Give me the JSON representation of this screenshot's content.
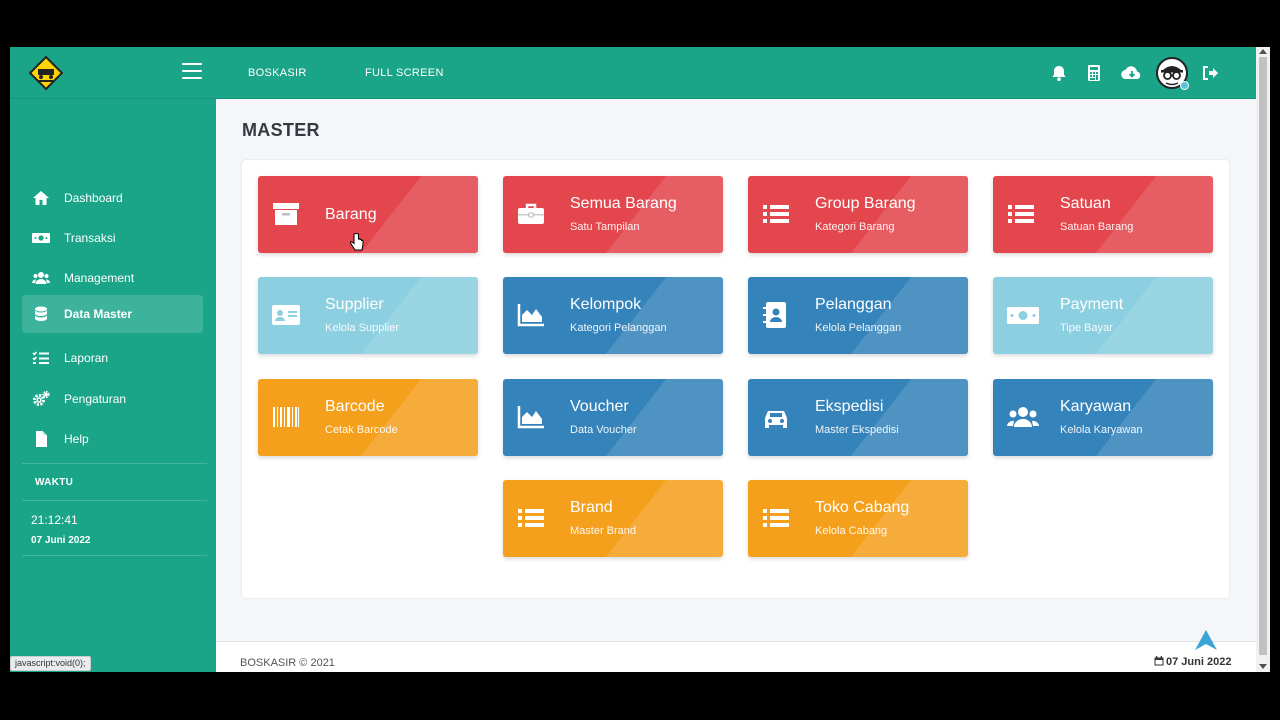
{
  "topbar": {
    "nav": [
      "BOSKASIR",
      "FULL SCREEN"
    ],
    "icons": [
      "bell-icon",
      "calculator-icon",
      "cloud-download-icon",
      "sign-out-icon"
    ],
    "accent": "#1aa589"
  },
  "sidebar": {
    "items": [
      {
        "label": "Dashboard",
        "icon": "home-icon"
      },
      {
        "label": "Transaksi",
        "icon": "money-icon"
      },
      {
        "label": "Management",
        "icon": "users-icon"
      },
      {
        "label": "Data Master",
        "icon": "database-icon",
        "active": true
      },
      {
        "label": "Laporan",
        "icon": "list-check-icon"
      },
      {
        "label": "Pengaturan",
        "icon": "cogs-icon"
      },
      {
        "label": "Help",
        "icon": "file-icon"
      }
    ],
    "waktu_header": "WAKTU",
    "clock": "21:12:41",
    "date": "07 Juni 2022"
  },
  "main": {
    "title": "MASTER",
    "tiles": [
      {
        "title": "Barang",
        "subtitle": "",
        "color": "#e3464c",
        "icon": "archive-icon"
      },
      {
        "title": "Semua Barang",
        "subtitle": "Satu Tampilan",
        "color": "#e3464c",
        "icon": "briefcase-icon"
      },
      {
        "title": "Group Barang",
        "subtitle": "Kategori Barang",
        "color": "#e3464c",
        "icon": "list-icon"
      },
      {
        "title": "Satuan",
        "subtitle": "Satuan Barang",
        "color": "#e3464c",
        "icon": "list-icon"
      },
      {
        "title": "Supplier",
        "subtitle": "Kelola Supplier",
        "color": "#8ccfe0",
        "icon": "id-card-icon"
      },
      {
        "title": "Kelompok",
        "subtitle": "Kategori Pelanggan",
        "color": "#3583bb",
        "icon": "area-chart-icon"
      },
      {
        "title": "Pelanggan",
        "subtitle": "Kelola Pelanggan",
        "color": "#3583bb",
        "icon": "address-book-icon"
      },
      {
        "title": "Payment",
        "subtitle": "Tipe Bayar",
        "color": "#8ccfe0",
        "icon": "money-bill-icon"
      },
      {
        "title": "Barcode",
        "subtitle": "Cetak Barcode",
        "color": "#f5a01d",
        "icon": "barcode-icon"
      },
      {
        "title": "Voucher",
        "subtitle": "Data Voucher",
        "color": "#3583bb",
        "icon": "area-chart-icon"
      },
      {
        "title": "Ekspedisi",
        "subtitle": "Master Ekspedisi",
        "color": "#3583bb",
        "icon": "car-icon"
      },
      {
        "title": "Karyawan",
        "subtitle": "Kelola Karyawan",
        "color": "#3583bb",
        "icon": "users-icon"
      },
      {
        "title": "Brand",
        "subtitle": "Master Brand",
        "color": "#f5a01d",
        "icon": "list-icon"
      },
      {
        "title": "Toko Cabang",
        "subtitle": "Kelola Cabang",
        "color": "#f5a01d",
        "icon": "list-icon"
      }
    ]
  },
  "footer": {
    "copyright": "BOSKASIR © 2021",
    "date": "07 Juni 2022"
  },
  "status_tip": "javascript:void(0);"
}
